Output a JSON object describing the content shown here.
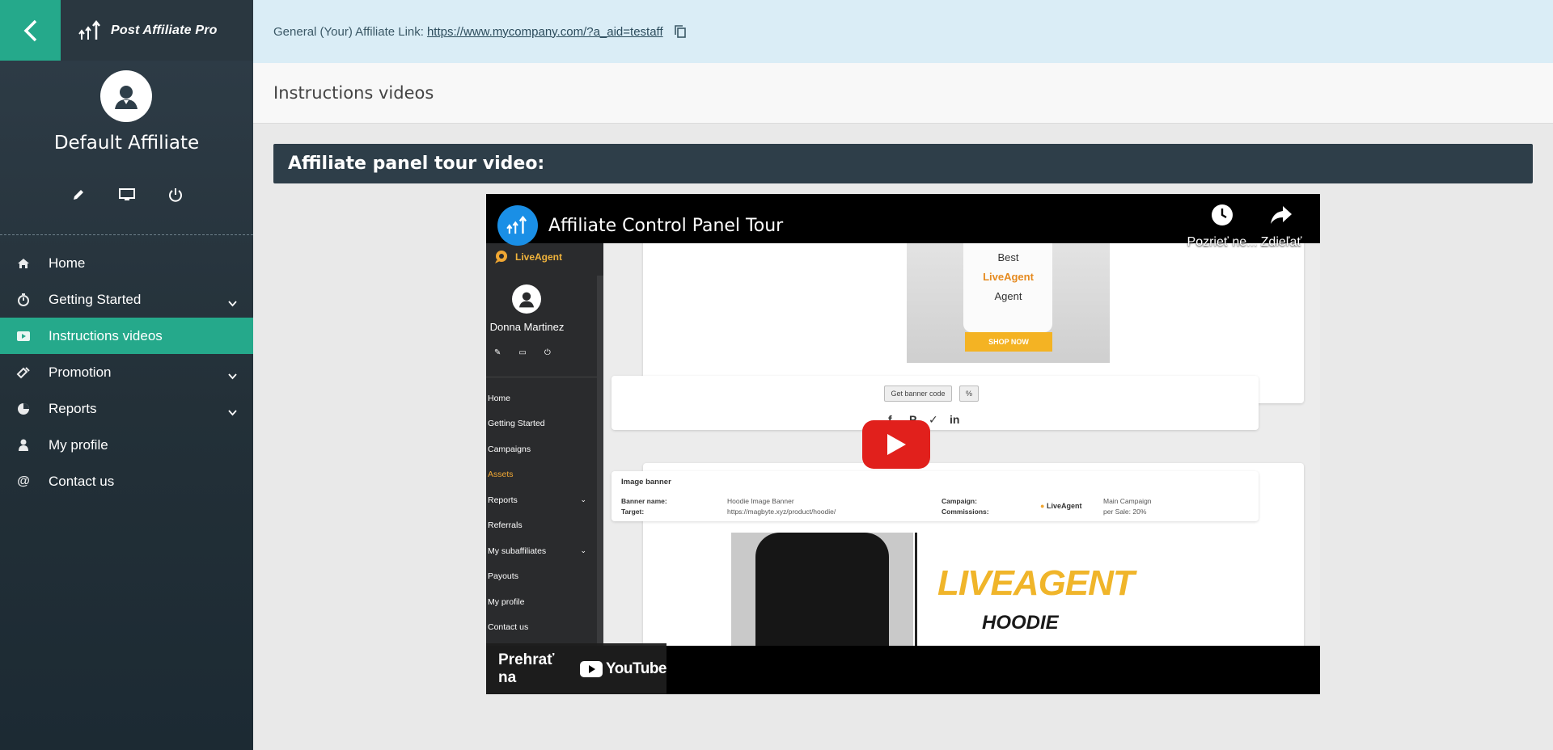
{
  "brand": {
    "name": "Post Affiliate Pro"
  },
  "user": {
    "name": "Default Affiliate"
  },
  "nav": [
    {
      "label": "Home",
      "icon": "home-icon"
    },
    {
      "label": "Getting Started",
      "icon": "stopwatch-icon",
      "expandable": true
    },
    {
      "label": "Instructions videos",
      "icon": "video-icon",
      "active": true
    },
    {
      "label": "Promotion",
      "icon": "promotion-icon",
      "expandable": true
    },
    {
      "label": "Reports",
      "icon": "chart-pie-icon",
      "expandable": true
    },
    {
      "label": "My profile",
      "icon": "user-icon"
    },
    {
      "label": "Contact us",
      "icon": "at-icon"
    }
  ],
  "topbar": {
    "label": "General (Your) Affiliate Link:",
    "link": "https://www.mycompany.com/?a_aid=testaff"
  },
  "page": {
    "title": "Instructions videos",
    "panel_title": "Affiliate panel tour video:"
  },
  "video": {
    "title": "Affiliate Control Panel Tour",
    "watch_later": "Pozrieť ne...",
    "share": "Zdieľať",
    "watch_on": "Prehrať na",
    "youtube": "YouTube",
    "frame": {
      "logo": "LiveAgent",
      "user": "Donna Martinez",
      "nav": [
        "Home",
        "Getting Started",
        "Campaigns",
        "Assets",
        "Reports",
        "Referrals",
        "My subaffiliates",
        "Payouts",
        "My profile",
        "Contact us"
      ],
      "mug_text": [
        "Best",
        "LiveAgent",
        "Agent"
      ],
      "shop_now": "SHOP NOW",
      "get_banner_code": "Get banner code",
      "image_banner": {
        "heading": "Image banner",
        "banner_name_label": "Banner name:",
        "banner_name": "Hoodie Image Banner",
        "target_label": "Target:",
        "target": "https://magbyte.xyz/product/hoodie/",
        "campaign_label": "Campaign:",
        "commissions_label": "Commissions:",
        "campaign": "Main Campaign",
        "commissions": "per Sale: 20%",
        "brand": "LiveAgent"
      },
      "hoodie_title": "LIVEAGENT",
      "hoodie_sub": "HOODIE"
    }
  },
  "colors": {
    "accent": "#25a98b",
    "sidebar": "#2a3740",
    "topbar": "#daedf6",
    "panel": "#2e3e49",
    "youtube_red": "#e1201c"
  }
}
